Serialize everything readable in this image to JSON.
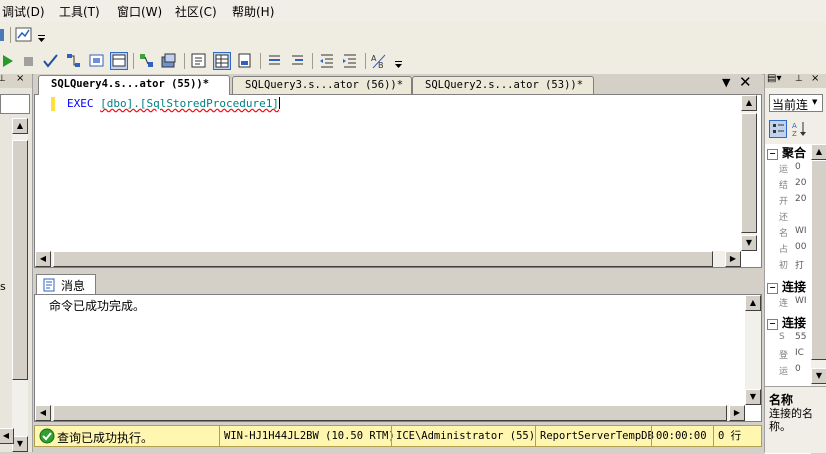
{
  "menu": {
    "items": [
      "调试(D)",
      "工具(T)",
      "窗口(W)",
      "社区(C)",
      "帮助(H)"
    ]
  },
  "tabs": [
    {
      "label": "SQLQuery4.s...ator (55))*",
      "active": true
    },
    {
      "label": "SQLQuery3.s...ator (56))*",
      "active": false
    },
    {
      "label": "SQLQuery2.s...ator (53))*",
      "active": false
    }
  ],
  "editor": {
    "keyword": "EXEC",
    "procedure": "[dbo].[SqlStoredProcedure1]"
  },
  "results": {
    "tab_label": "消息",
    "message": "命令已成功完成。"
  },
  "status": {
    "message": "查询已成功执行。",
    "server": "WIN-HJ1H44JL2BW (10.50 RTM)",
    "user": "ICE\\Administrator (55)",
    "database": "ReportServerTempDB",
    "elapsed": "00:00:00",
    "rows": "0 行"
  },
  "left_panel": {
    "label": "s"
  },
  "properties": {
    "dropdown": "当前连",
    "category_aggregate": "聚合",
    "category_connection1": "连接",
    "category_connection2": "连接",
    "rows_group1": [
      {
        "name": "运",
        "value": "0"
      },
      {
        "name": "结",
        "value": "20"
      },
      {
        "name": "开",
        "value": "20"
      },
      {
        "name": "还",
        "value": ""
      },
      {
        "name": "名",
        "value": "WI"
      },
      {
        "name": "占",
        "value": "00"
      },
      {
        "name": "初",
        "value": "打"
      }
    ],
    "rows_group2": [
      {
        "name": "连",
        "value": "WI"
      }
    ],
    "rows_group3": [
      {
        "name": "S",
        "value": "55"
      },
      {
        "name": "登",
        "value": "IC"
      },
      {
        "name": "运",
        "value": "0"
      }
    ],
    "desc_title": "名称",
    "desc_text": "连接的名称。"
  },
  "colors": {
    "status_bg": "#fff7b0",
    "keyword": "#0000ff",
    "identifier": "#008080"
  }
}
